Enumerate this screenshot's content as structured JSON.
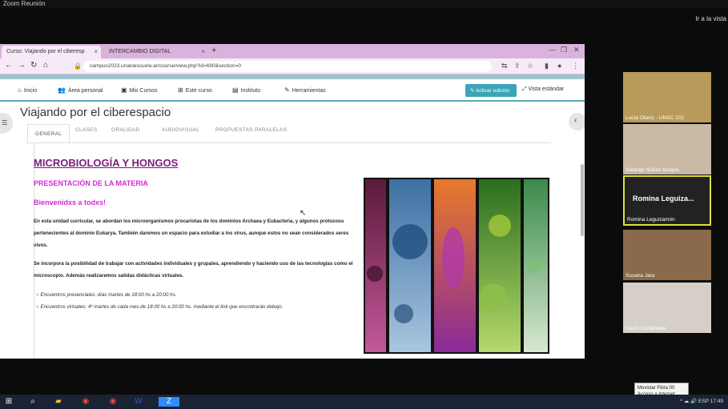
{
  "zoom": {
    "window_title": "Zoom Reunión",
    "view_label": "Ir a la vista",
    "tooltip_line1": "Movistar Fibra 00",
    "tooltip_line2": "Acceso a Internet"
  },
  "browser": {
    "tabs": [
      {
        "label": "Curso: Viajando por el ciberesp",
        "close": "×"
      },
      {
        "label": "INTERCAMBIO DIGITAL",
        "close": "×"
      }
    ],
    "new_tab": "+",
    "window_controls": [
      "—",
      "❐",
      "✕"
    ],
    "url": "campus2023.unaloescuela.ar/course/view.php?id=690&section=0"
  },
  "site_nav": {
    "items": [
      {
        "icon": "home-icon",
        "label": "Inicio"
      },
      {
        "icon": "users-icon",
        "label": "Área personal"
      },
      {
        "icon": "briefcase-icon",
        "label": "Mis Cursos"
      },
      {
        "icon": "sitemap-icon",
        "label": "Este curso"
      },
      {
        "icon": "book-icon",
        "label": "Instituto"
      },
      {
        "icon": "wrench-icon",
        "label": "Herramientas"
      }
    ],
    "edit_button": "Activar edición",
    "view_button": "Vista estándar"
  },
  "course": {
    "title": "Viajando por el ciberespacio",
    "tabs": [
      "GENERAL",
      "CLASES",
      "ORALIDAD",
      "AUDIOVISUAL",
      "PROPUESTAS PARALELAS"
    ],
    "active_tab": 0
  },
  "content": {
    "heading": "MICROBIOLOGÍA Y HONGOS",
    "subheading": "PRESENTACIÓN DE LA MATERIA",
    "welcome": "Bienvenidxs a todxs!",
    "para1": "En esta unidad curricular, se abordan los microorganismos procariotas de los dominios Archaea y Eubacteria, y algunos protozoos pertenecientes al dominio Eukarya. También daremos un espacio para estudiar a los virus, aunque estos no sean considerados seres vivos.",
    "para2": "Se incorpora la posibilidad de trabajar con actividades individuales y grupales, aprendiendo y haciendo uso de las tecnologías como el microscopio. Además realizaremos salidas didácticas virtuales.",
    "bullet1": "Encuentros presenciales: días martes de 18:00 hs a 20:00 hs.",
    "bullet2": "Encuentros virtuales: 4º martes de cada mes de 18:00 hs a 20:00 hs. mediante el link que encontrarán debajo."
  },
  "participants": [
    {
      "name": "Lucía Olaniz - UNSC 102"
    },
    {
      "name": "Solange Núñez Burgos"
    },
    {
      "name": "Romina Leguizamón",
      "big_label": "Romina Leguiza..."
    },
    {
      "name": "Susana Jara"
    },
    {
      "name": "Laura Castañeda"
    }
  ],
  "taskbar": {
    "tray_text": "^ ☁ 🔊 ESP  17:49",
    "language": "ESP"
  },
  "colors": {
    "accent": "#3aa5b8",
    "heading": "#7a1c7a",
    "magenta": "#d12bd1",
    "tabstrip": "#d9b3dc"
  }
}
